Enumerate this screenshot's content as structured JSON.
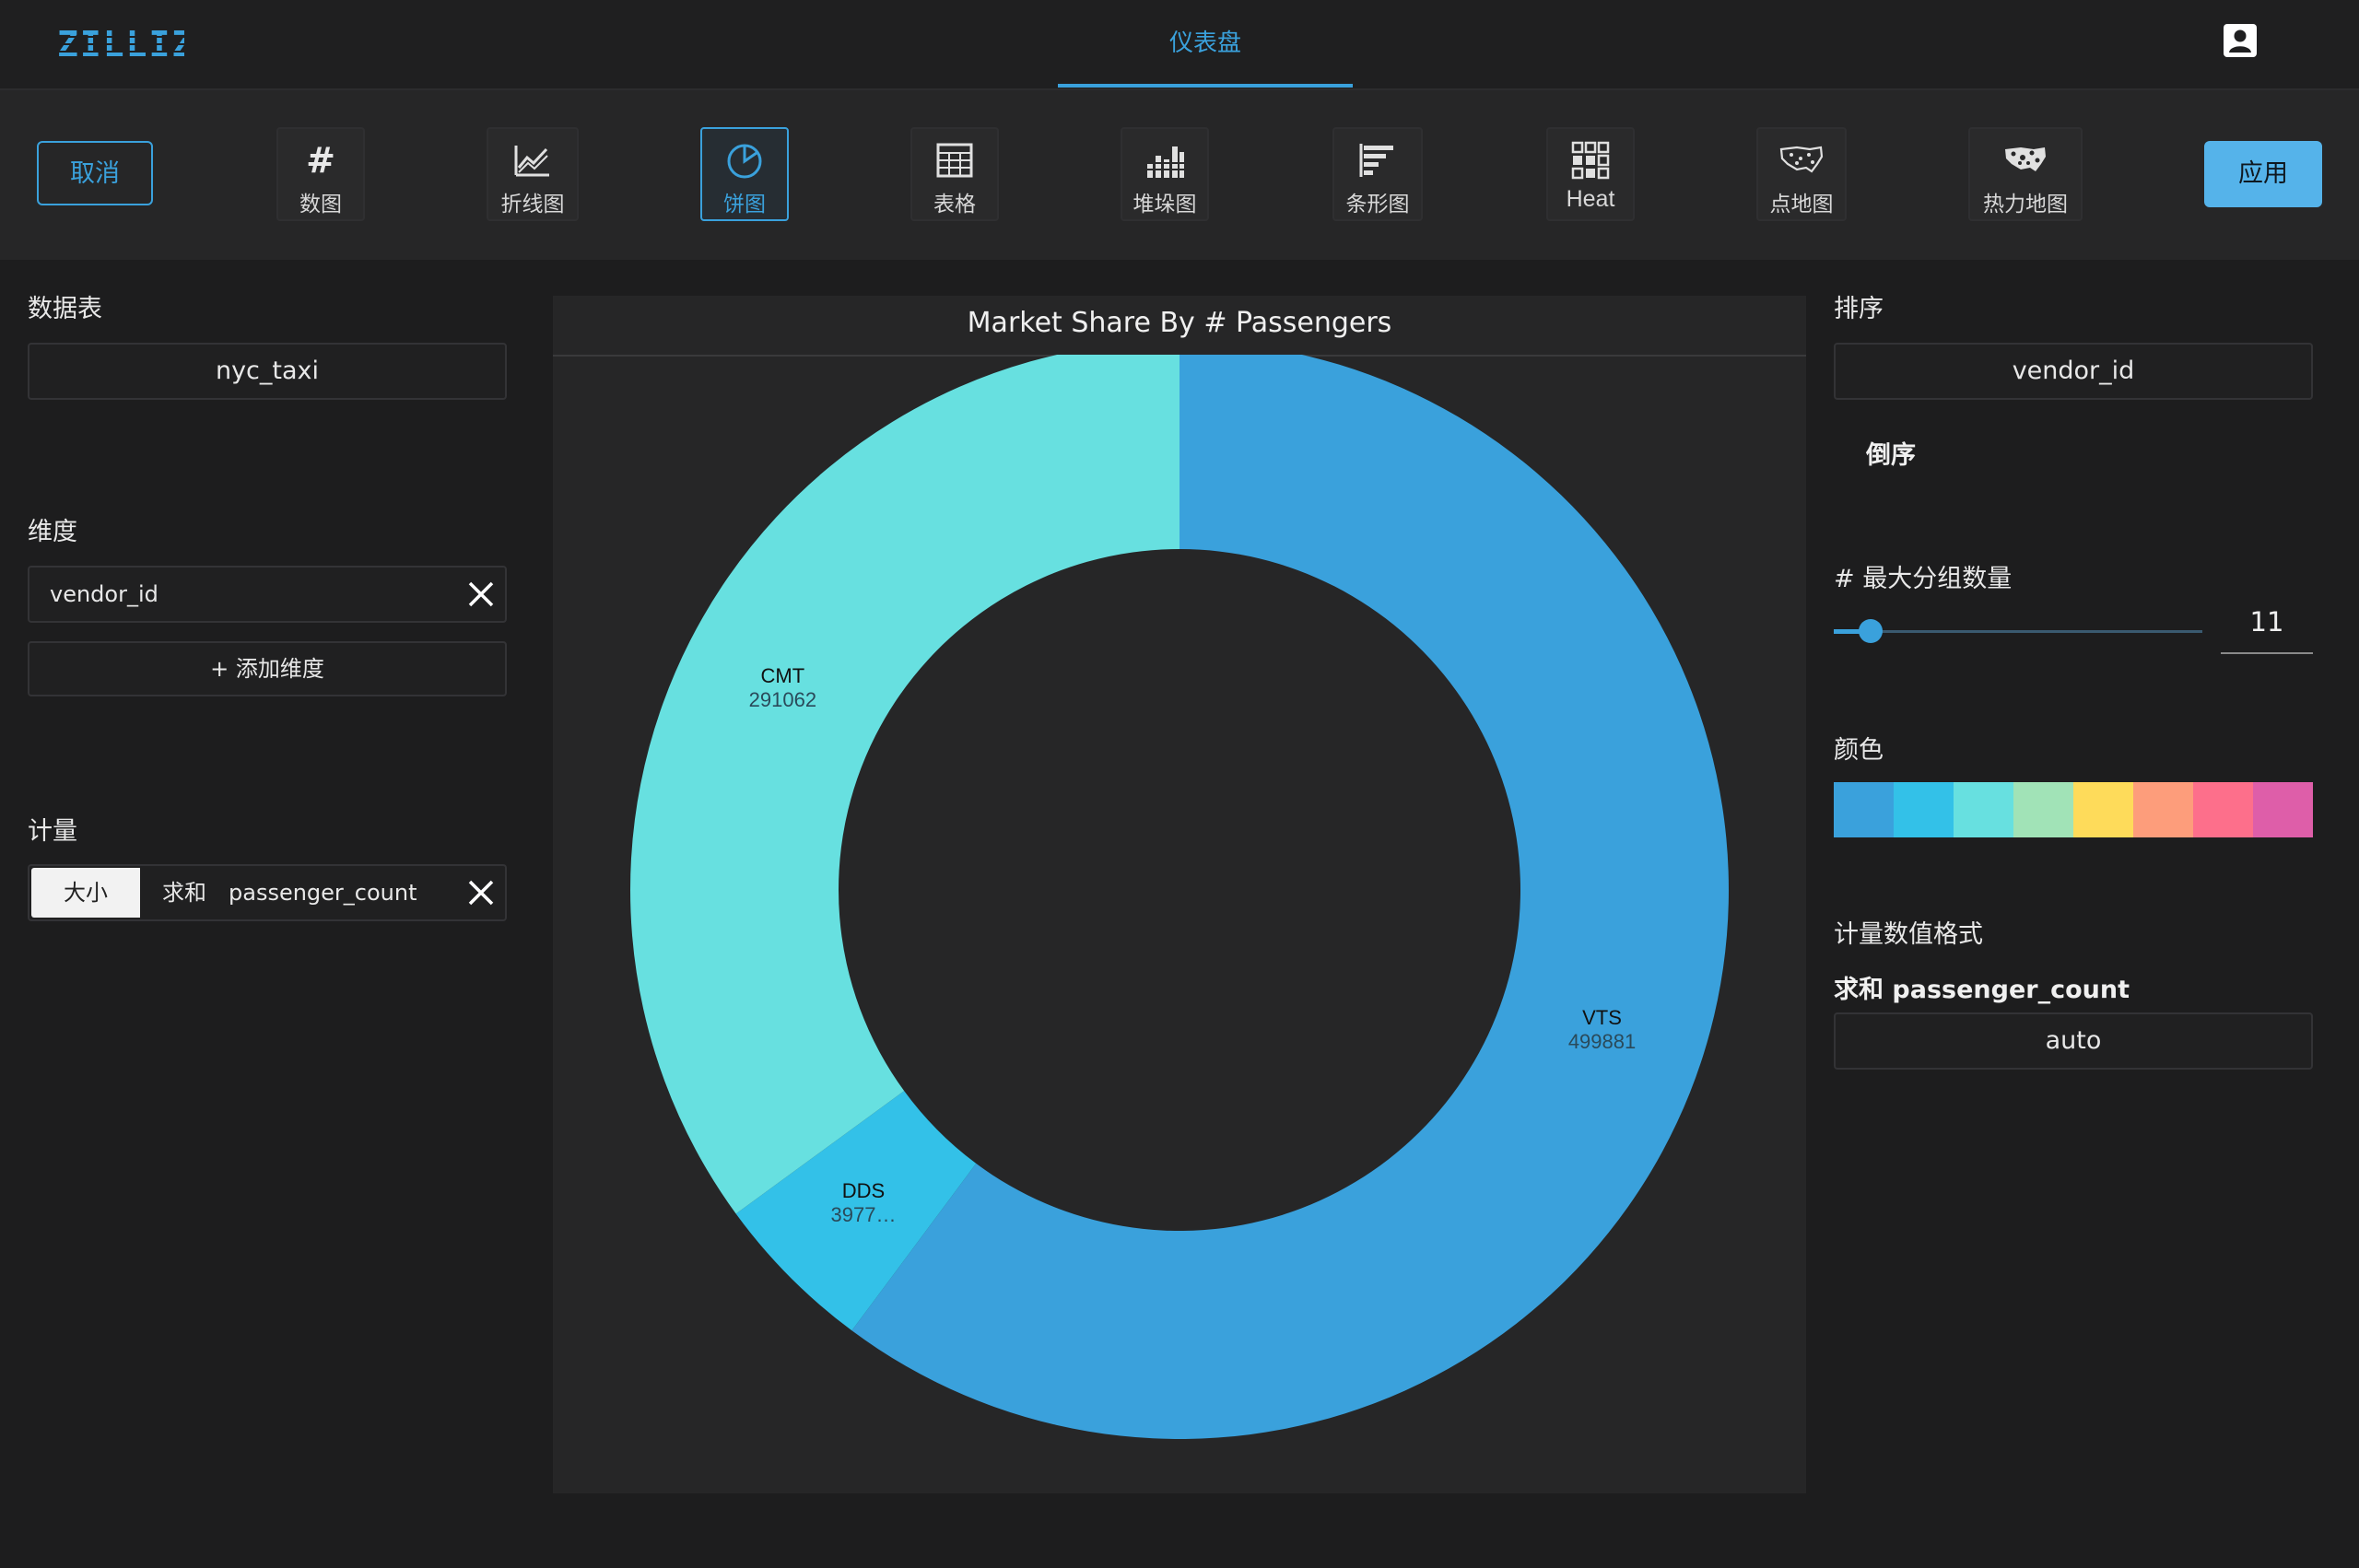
{
  "app": {
    "logo": "ZILLIZ",
    "nav_tab": "仪表盘"
  },
  "toolbar": {
    "cancel_label": "取消",
    "apply_label": "应用",
    "chart_types": [
      {
        "label": "数图",
        "icon": "hash-icon",
        "selected": false
      },
      {
        "label": "折线图",
        "icon": "line-chart-icon",
        "selected": false
      },
      {
        "label": "饼图",
        "icon": "pie-chart-icon",
        "selected": true
      },
      {
        "label": "表格",
        "icon": "table-icon",
        "selected": false
      },
      {
        "label": "堆垛图",
        "icon": "stacked-bar-icon",
        "selected": false
      },
      {
        "label": "条形图",
        "icon": "horizontal-bar-icon",
        "selected": false
      },
      {
        "label": "Heat",
        "icon": "heat-grid-icon",
        "selected": false
      },
      {
        "label": "点地图",
        "icon": "point-map-icon",
        "selected": false
      },
      {
        "label": "热力地图",
        "icon": "heat-map-icon",
        "selected": false
      }
    ]
  },
  "left_panel": {
    "table_label": "数据表",
    "table_value": "nyc_taxi",
    "dimension_label": "维度",
    "dimension_value": "vendor_id",
    "add_dimension_label": "+ 添加维度",
    "measure_label": "计量",
    "measure_tag": "大小",
    "measure_agg": "求和",
    "measure_field": "passenger_count"
  },
  "chart_data": {
    "type": "pie",
    "title": "Market Share By # Passengers",
    "donut": true,
    "slices": [
      {
        "label": "VTS",
        "value": 499881,
        "value_label": "499881",
        "color": "#3aa1dc"
      },
      {
        "label": "DDS",
        "value": 39770,
        "value_label": "3977…",
        "color": "#33c1e8"
      },
      {
        "label": "CMT",
        "value": 291062,
        "value_label": "291062",
        "color": "#67e0e0"
      }
    ]
  },
  "right_panel": {
    "sort_label": "排序",
    "sort_value": "vendor_id",
    "order_label": "倒序",
    "max_groups_label": "# 最大分组数量",
    "max_groups_value": "11",
    "color_label": "颜色",
    "palette": [
      "#3aa1dc",
      "#33c1e8",
      "#67e0e0",
      "#a1e3b7",
      "#fedb5a",
      "#fd9d7b",
      "#fd6f8b",
      "#de5ea9"
    ],
    "format_label": "计量数值格式",
    "format_measure": "求和 passenger_count",
    "format_value": "auto"
  },
  "colors": {
    "accent": "#3aa1dc",
    "background": "#1d1d1e"
  }
}
